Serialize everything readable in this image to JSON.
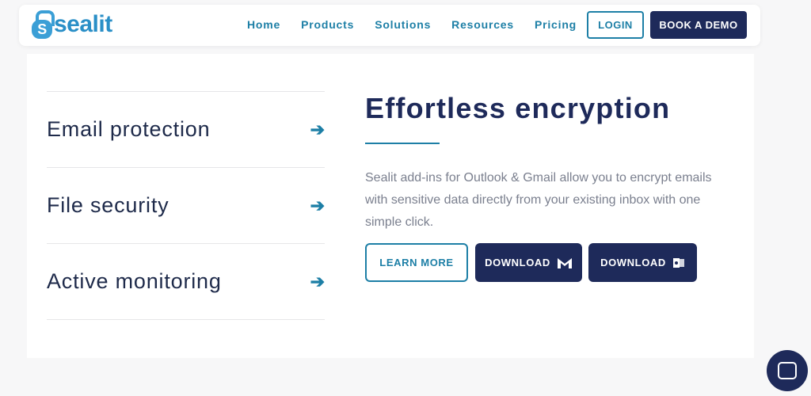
{
  "nav": {
    "brand": "sealit",
    "links": [
      "Home",
      "Products",
      "Solutions",
      "Resources",
      "Pricing"
    ],
    "login": "LOGIN",
    "demo": "BOOK A DEMO"
  },
  "features": [
    {
      "label": "Email protection"
    },
    {
      "label": "File security"
    },
    {
      "label": "Active monitoring"
    }
  ],
  "main": {
    "title": "Effortless encryption",
    "description": "Sealit add-ins for Outlook & Gmail allow you to encrypt emails with sensitive data directly from your existing inbox with one simple click.",
    "learn_more": "LEARN MORE",
    "download_gmail": "DOWNLOAD",
    "download_outlook": "DOWNLOAD"
  },
  "colors": {
    "primary": "#1e2a5a",
    "accent": "#1d7fa6"
  }
}
